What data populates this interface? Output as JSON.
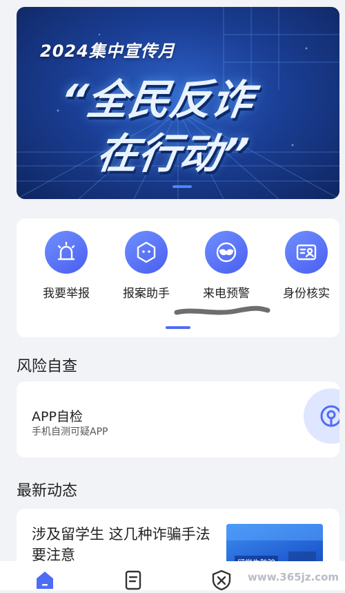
{
  "banner": {
    "subtitle": "2024集中宣传月",
    "title_line1": "“全民反诈",
    "title_line2": "在行动”"
  },
  "quick_actions": [
    {
      "label": "我要举报",
      "icon": "alarm-light-icon"
    },
    {
      "label": "报案助手",
      "icon": "robot-face-icon"
    },
    {
      "label": "来电预警",
      "icon": "mask-icon"
    },
    {
      "label": "身份核实",
      "icon": "id-card-icon"
    }
  ],
  "risk_section": {
    "title": "风险自查",
    "card": {
      "title": "APP自检",
      "subtitle": "手机自测可疑APP",
      "icon": "scan-target-icon"
    }
  },
  "news_section": {
    "title": "最新动态",
    "items": [
      {
        "title": "涉及留学生  这几种诈骗手法要注意",
        "thumb_tag": "留学生防骗"
      }
    ]
  },
  "bottom_nav": [
    "home-icon",
    "report-doc-icon",
    "shield-cross-icon"
  ],
  "watermark": "www.365jz.com",
  "colors": {
    "accent": "#4f6cf6",
    "banner_dark": "#0f2560",
    "page_bg": "#f2f3f7"
  }
}
